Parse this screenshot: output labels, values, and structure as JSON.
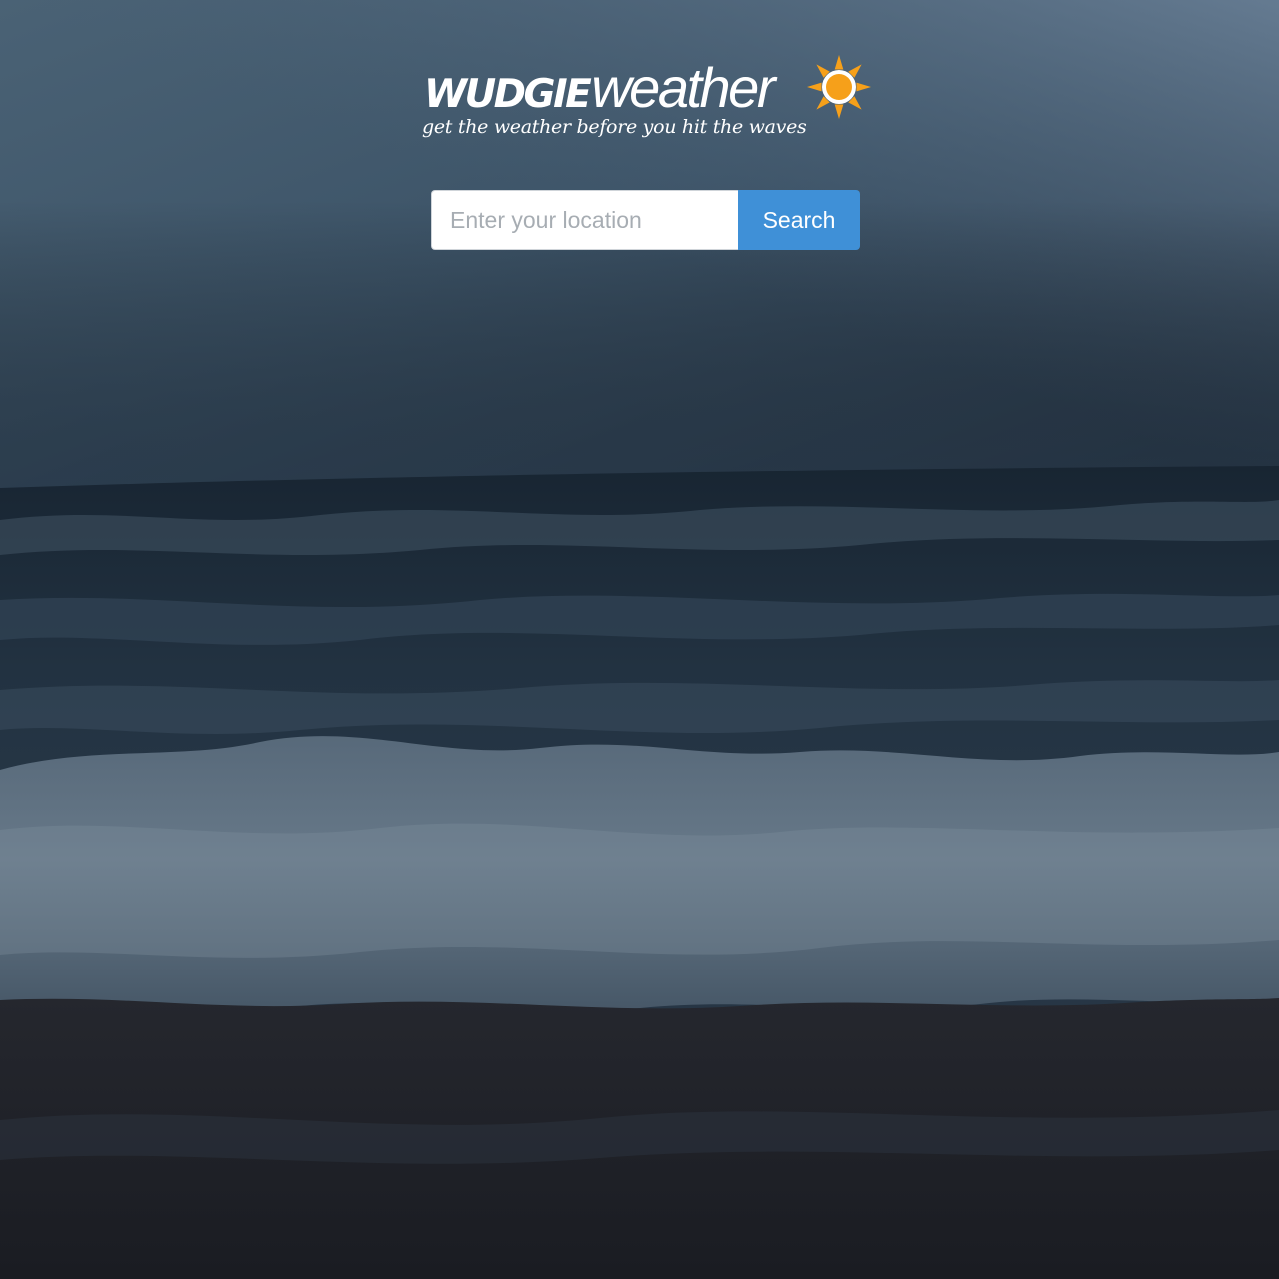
{
  "brand": {
    "name_bold": "WUDGIE",
    "name_light": "weather",
    "tagline": "get the weather before you hit the waves",
    "sun_color": "#f6a01a"
  },
  "search": {
    "placeholder": "Enter your location",
    "value": "",
    "button_label": "Search",
    "button_color": "#3f90d7"
  },
  "background": {
    "scene": "ocean-waves-at-dusk"
  }
}
